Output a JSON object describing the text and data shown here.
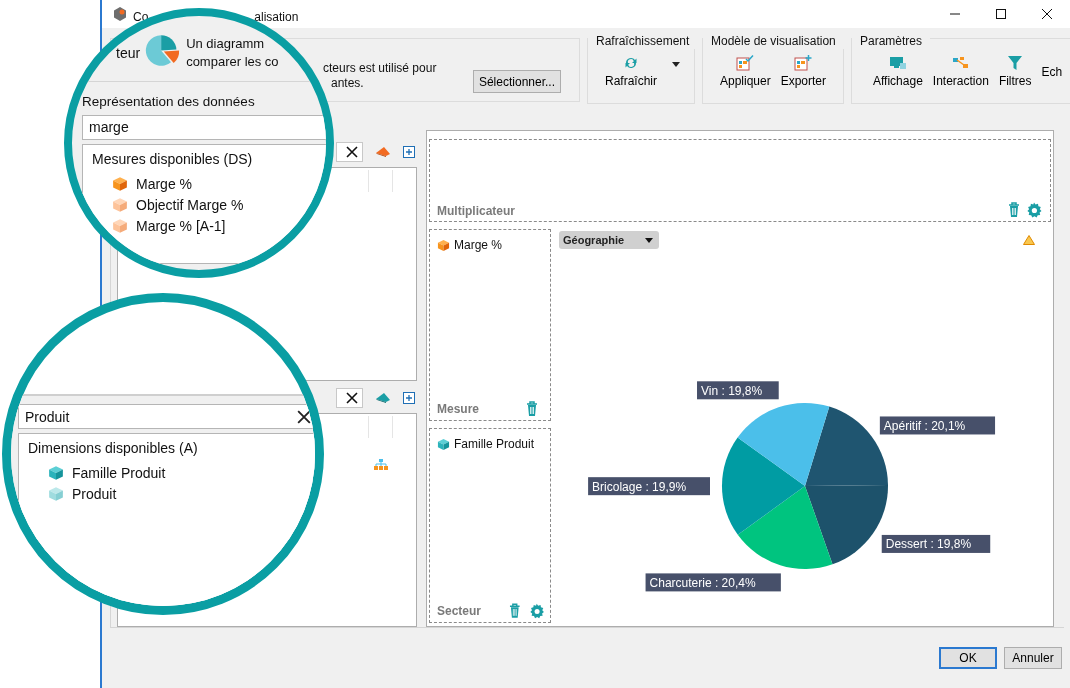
{
  "window": {
    "title_parts": [
      "Co",
      "alisation"
    ]
  },
  "ribbon": {
    "chart_type": {
      "description_lines": [
        "cteurs est utilisé pour",
        "antes."
      ],
      "select_button": "Sélectionner..."
    },
    "groups": [
      {
        "label": "Rafraîchissement",
        "buttons": [
          {
            "label": "Rafraîchir",
            "kind": "refresh"
          }
        ]
      },
      {
        "label": "Modèle de visualisation",
        "buttons": [
          {
            "label": "Appliquer",
            "kind": "apply"
          },
          {
            "label": "Exporter",
            "kind": "export"
          }
        ]
      },
      {
        "label": "Paramètres",
        "buttons": [
          {
            "label": "Affichage",
            "kind": "display"
          },
          {
            "label": "Interaction",
            "kind": "interaction"
          },
          {
            "label": "Filtres",
            "kind": "filter"
          },
          {
            "label": "Ech",
            "kind": "cut"
          }
        ]
      }
    ]
  },
  "design": {
    "multiplier_zone": {
      "label": "Multiplicateur"
    },
    "measure_zone": {
      "label": "Mesure",
      "items": [
        {
          "label": "Marge %",
          "kind": "measure"
        }
      ]
    },
    "sector_zone": {
      "label": "Secteur",
      "items": [
        {
          "label": "Famille Produit",
          "kind": "dimension"
        }
      ]
    },
    "chart": {
      "dropdown": "Géographie",
      "chart_data": {
        "type": "pie",
        "values": [
          20.1,
          19.8,
          20.4,
          19.9,
          19.8
        ],
        "value_labels": [
          "Apéritif : 20,1%",
          "Dessert : 19,8%",
          "Charcuterie : 20,4%",
          "Bricolage : 19,9%",
          "Vin : 19,8%"
        ]
      }
    }
  },
  "buttons": [
    {
      "label": "OK",
      "default": true
    },
    {
      "label": "Annuler",
      "default": false
    }
  ],
  "magnifier_measures": {
    "ribbon_label": "teur",
    "description_lines": [
      "Un diagramm",
      "comparer les co"
    ],
    "section_title": "Représentation des données",
    "search_value": "marge",
    "list_title": "Mesures disponibles (DS)",
    "items": [
      {
        "label": "Marge %",
        "kind": "primary"
      },
      {
        "label": "Objectif Marge %",
        "kind": "secondary"
      },
      {
        "label": "Marge % [A-1]",
        "kind": "secondary"
      }
    ]
  },
  "magnifier_dimensions": {
    "search_value": "Produit",
    "list_title": "Dimensions disponibles (A)",
    "items": [
      {
        "label": "Famille Produit",
        "kind": "primary"
      },
      {
        "label": "Produit",
        "kind": "secondary"
      }
    ]
  }
}
